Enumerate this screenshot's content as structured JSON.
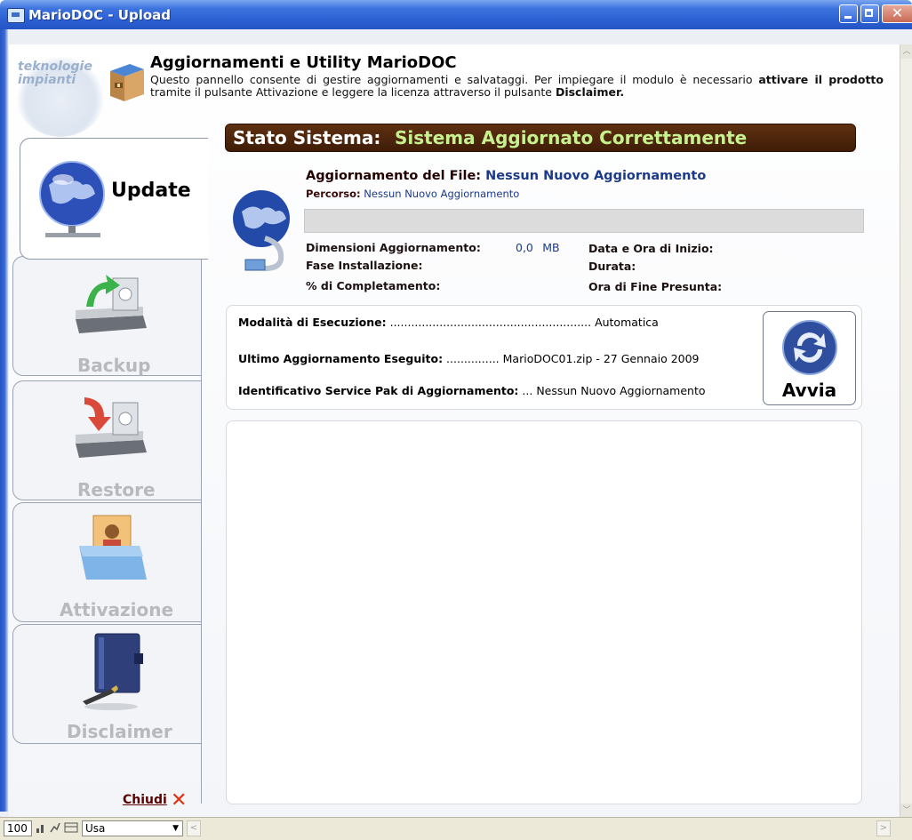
{
  "window": {
    "title": "MarioDOC - Upload",
    "close_glyph": "✕"
  },
  "header": {
    "logo_text": "teknologie impianti",
    "title": "Aggiornamenti e Utility MarioDOC",
    "desc_1": "Questo pannello consente di gestire aggiornamenti e salvataggi. Per impiegare il modulo è necessario",
    "desc_bold_1": "attivare il prodotto",
    "desc_2": " tramite il pulsante Attivazione e leggere la licenza attraverso il pulsante ",
    "desc_bold_2": "Disclaimer."
  },
  "status": {
    "label": "Stato Sistema:",
    "value": "Sistema Aggiornato Correttamente"
  },
  "tabs": [
    {
      "label": "Update",
      "icon": "globe-network-icon",
      "active": true
    },
    {
      "label": "Backup",
      "icon": "drive-upload-icon"
    },
    {
      "label": "Restore",
      "icon": "drive-download-icon"
    },
    {
      "label": "Attivazione",
      "icon": "contact-folder-icon"
    },
    {
      "label": "Disclaimer",
      "icon": "notebook-pen-icon"
    }
  ],
  "update": {
    "file_label": "Aggiornamento del File:",
    "file_value": "Nessun Nuovo Aggiornamento",
    "path_label": "Percorso:",
    "path_value": "Nessun Nuovo Aggiornamento",
    "progress": 0,
    "size_label": "Dimensioni Aggiornamento:",
    "size_value": "0,0",
    "size_unit": "MB",
    "phase_label": "Fase Installazione:",
    "percent_label": "% di Completamento:",
    "start_label": "Data e Ora di Inizio:",
    "duration_label": "Durata:",
    "end_label": "Ora di Fine Presunta:"
  },
  "execution": {
    "mode_label": "Modalità di Esecuzione:",
    "mode_dots": " ......................................................... ",
    "mode_value": "Automatica",
    "last_label": "Ultimo Aggiornamento Eseguito:",
    "last_dots": " ............... ",
    "last_value": "MarioDOC01.zip - 27 Gennaio 2009",
    "spak_label": "Identificativo Service Pak di Aggiornamento:",
    "spak_dots": " ... ",
    "spak_value": "Nessun Nuovo Aggiornamento",
    "run_button": "Avvia"
  },
  "close_link": "Chiudi",
  "statusbar": {
    "zoom": "100",
    "lang": "Usa"
  },
  "colors": {
    "banner": "#4a230b",
    "status_green": "#c7f08f",
    "title_blue": "#2b5fd2",
    "value_blue": "#1c3a8a"
  }
}
